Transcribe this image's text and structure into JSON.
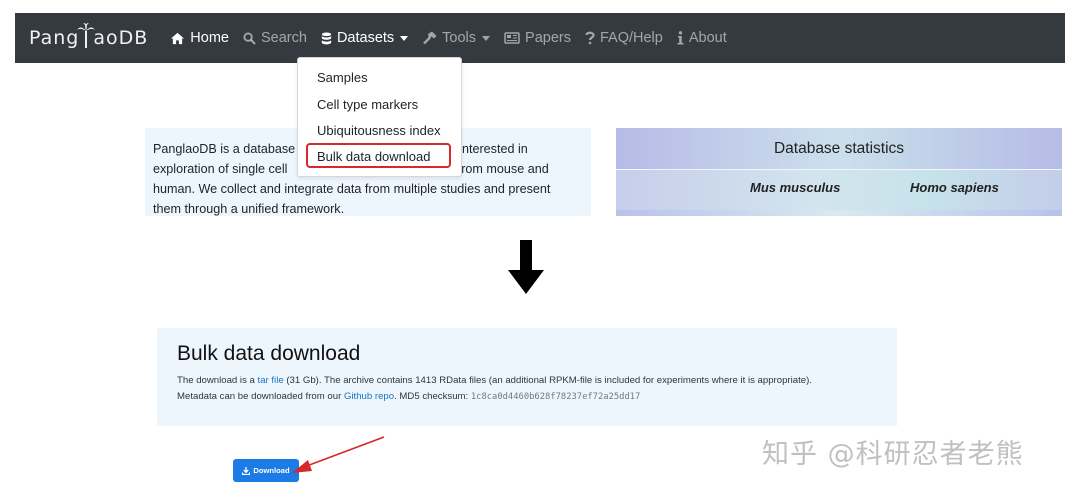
{
  "navbar": {
    "brand_prefix": "Pang",
    "brand_suffix": "aoDB",
    "items": [
      {
        "label": "Home",
        "icon": "home-icon",
        "active": true
      },
      {
        "label": "Search",
        "icon": "search-icon"
      },
      {
        "label": "Datasets",
        "icon": "database-icon",
        "dropdown": true
      },
      {
        "label": "Tools",
        "icon": "hammer-icon",
        "dropdown": true
      },
      {
        "label": "Papers",
        "icon": "newspaper-icon"
      },
      {
        "label": "FAQ/Help",
        "icon": "question-icon"
      },
      {
        "label": "About",
        "icon": "info-icon"
      }
    ]
  },
  "datasets_menu": {
    "items": [
      "Samples",
      "Cell type markers",
      "Ubiquitousness index",
      "Bulk data download"
    ],
    "highlighted": "Bulk data download"
  },
  "intro": {
    "lines": [
      "PanglaoDB is a database",
      "interested in",
      "exploration of single cell",
      "ts from mouse and",
      "human. We collect and integrate data from multiple studies and present",
      "them through a unified framework."
    ]
  },
  "stats": {
    "title": "Database statistics",
    "col1": "Mus musculus",
    "col2": "Homo sapiens"
  },
  "bulk": {
    "title": "Bulk data download",
    "line1_a": "The download is a ",
    "line1_link": "tar file",
    "line1_b": " (31 Gb). The archive contains 1413 RData files (an additional RPKM-file is included for experiments where it is appropriate).",
    "line2_a": "Metadata can be downloaded from our ",
    "line2_link": "Github repo",
    "line2_b": ". MD5 checksum: ",
    "checksum": "1c8ca0d4460b628f78237ef72a25dd17"
  },
  "download_button": {
    "label": "Download",
    "icon": "download-icon"
  },
  "watermark": "知乎 @科研忍者老熊",
  "colors": {
    "navbar_bg": "#343a40",
    "highlight_red": "#d8282b",
    "button_blue": "#1c7be6",
    "panel_bg": "#eef6fd",
    "link_blue": "#1a73c0"
  }
}
